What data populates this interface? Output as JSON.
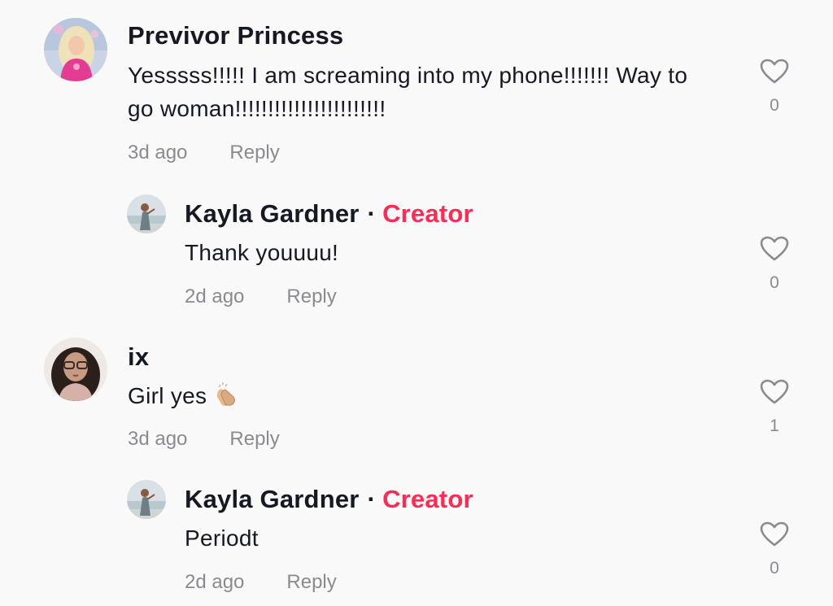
{
  "colors": {
    "creator": "#fe2c55",
    "meta": "#8a8b91",
    "text": "#161823",
    "background": "#f9f9f9"
  },
  "comments": [
    {
      "username": "Previvor Princess",
      "text_line1": "Yesssss!!!!! I am screaming into my phone!!!!!!! Way to",
      "text_line2": "go woman!!!!!!!!!!!!!!!!!!!!!!!",
      "time": "3d ago",
      "reply_label": "Reply",
      "likes": "0",
      "reply": {
        "username": "Kayla Gardner",
        "separator": "·",
        "badge": "Creator",
        "text": "Thank youuuu!",
        "time": "2d ago",
        "reply_label": "Reply",
        "likes": "0"
      }
    },
    {
      "username": "ix",
      "text": "Girl yes",
      "emoji": "clapping-hands-icon",
      "time": "3d ago",
      "reply_label": "Reply",
      "likes": "1",
      "reply": {
        "username": "Kayla Gardner",
        "separator": "·",
        "badge": "Creator",
        "text": "Periodt",
        "time": "2d ago",
        "reply_label": "Reply",
        "likes": "0"
      }
    }
  ]
}
